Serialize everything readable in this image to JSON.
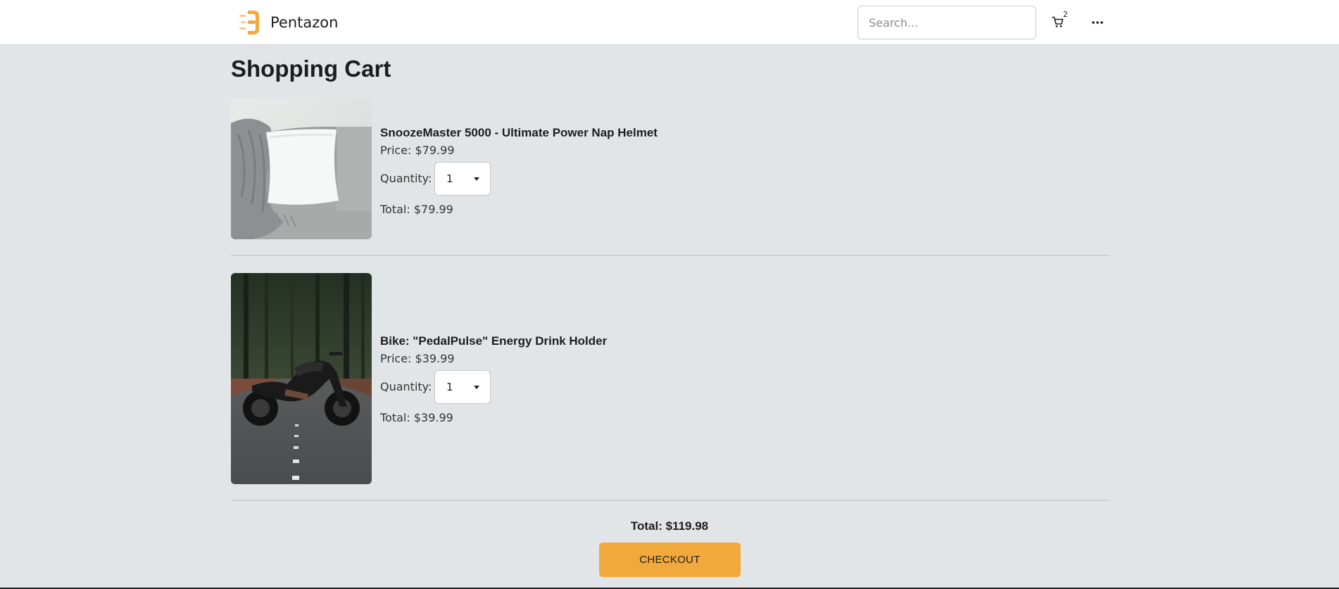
{
  "header": {
    "brand": "Pentazon",
    "logo_icon": "pentazon-logo-icon",
    "search_placeholder": "Search...",
    "cart_count": "2",
    "cart_icon": "shopping-cart-icon",
    "more_icon": "more-horizontal-icon"
  },
  "page": {
    "title": "Shopping Cart"
  },
  "cart": {
    "items": [
      {
        "name": "SnoozeMaster 5000 - Ultimate Power Nap Helmet",
        "price": "Price: $79.99",
        "quantity_label": "Quantity:",
        "quantity": "1",
        "total": "Total: $79.99",
        "image_icon": "pillow-photo"
      },
      {
        "name": "Bike: \"PedalPulse\" Energy Drink Holder",
        "price": "Price: $39.99",
        "quantity_label": "Quantity:",
        "quantity": "1",
        "total": "Total: $39.99",
        "image_icon": "motorcycle-photo"
      }
    ],
    "grand_total": "Total: $119.98",
    "checkout_label": "CHECKOUT"
  },
  "colors": {
    "background": "#e2e5e7",
    "header": "#ffffff",
    "accent": "#f2a93b",
    "text": "#1d1d1f"
  }
}
